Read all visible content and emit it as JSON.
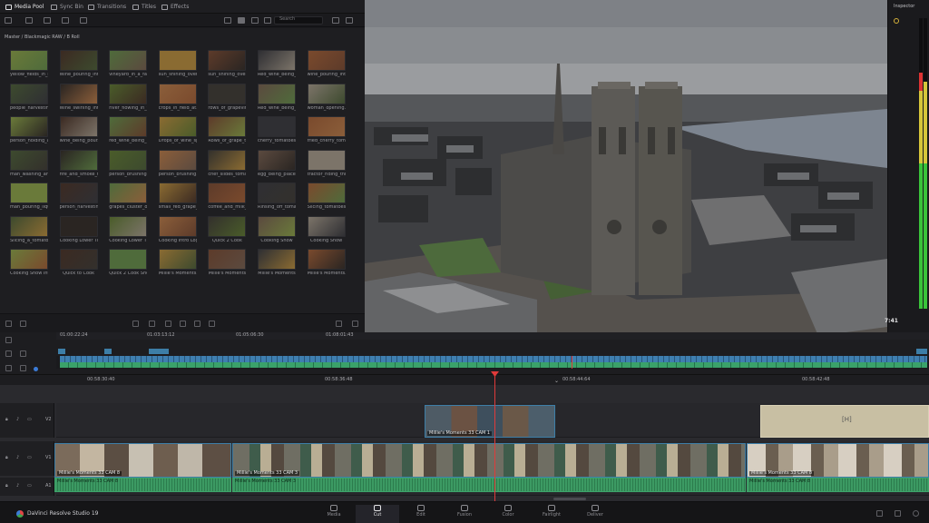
{
  "top_tabs": [
    "Media Pool",
    "Sync Bin",
    "Transitions",
    "Titles",
    "Effects"
  ],
  "search_placeholder": "Search",
  "breadcrumb": "Master / Blackmagic RAW / B Roll",
  "inspector_label": "Inspector",
  "viewer_timecode": "7:41",
  "clips": [
    [
      "yellow_fields_in_la...",
      "Wine_pouring_into...",
      "vineyard_in_a_far...",
      "sun_shining_over...",
      "sun_shining_over...",
      "Red_wine_being_pour...",
      "wine_pouring_into..."
    ],
    [
      "people_harvesting...",
      "Wine_swirling_into...",
      "river_flowing_in_t...",
      "crops_in_field_at...",
      "rows_of_grapevin...",
      "Red_wine_being_po...",
      "woman_opening..."
    ],
    [
      "person_holding_a...",
      "wine_being_pour...",
      "red_wine_being_p...",
      "Drops_of_wine_sp...",
      "Rows_of_grape_tr...",
      "cherry_tomatoes...",
      "fried_cherry_tomat..."
    ],
    [
      "man_washing_an...",
      "fire_and_smoke_f...",
      "person_brushing...",
      "person_brushing...",
      "chef_slides_tomat...",
      "egg_being_placed...",
      "tractor_riding_thro..."
    ],
    [
      "man_pouring_liqu...",
      "person_harvestin...",
      "grapes_cluster_on...",
      "small_red_grape_f...",
      "coffee_and_milk_b...",
      "Rinsing_off_tomat...",
      "Slicing_tomatoes..."
    ],
    [
      "Slicing_a_tomato...",
      "Cooking Lower Thi...",
      "Cooking Lower Thi...",
      "Cooking Intro Log...",
      "Quick 2 Cook",
      "Cooking Show",
      "Cooking Show"
    ],
    [
      "Cooking Show Int...",
      "Quick to Cook",
      "Quick 2 Cook Sheet",
      "Millie's Moments...",
      "Millie's Moments",
      "Millie's Moments",
      "Millie's Moments..."
    ]
  ],
  "ruler_marks": [
    "01:00:22:24",
    "01:03:13:12",
    "01:05:06:30",
    "01:08:01:43"
  ],
  "timeline_marks": [
    "00:58:30:40",
    "00:58:36:48",
    "00:58:44:64",
    "00:58:42:48"
  ],
  "tracks": {
    "v2": "V2",
    "v1": "V1",
    "a1": "A1"
  },
  "clip_labels": {
    "v2": "Millie's Moments 33 CAM 1",
    "v1_a": "Millie's Moments 33 CAM 8",
    "v1_b": "Millie's Moments 33 CAM 3",
    "v1_c": "Millie's Moments 33 CAM 8",
    "a1_a": "Millie's Moments 33 CAM 8",
    "a1_b": "Millie's Moments 33 CAM 3",
    "a1_c": "Millie's Moments 33 CAM 8"
  },
  "app_name": "DaVinci Resolve Studio 19",
  "pages": [
    "Media",
    "Cut",
    "Edit",
    "Fusion",
    "Color",
    "Fairlight",
    "Deliver"
  ],
  "active_page": "Cut",
  "colors": {
    "playhead": "#e03a3a",
    "video_clip": "#3d7ea7",
    "audio_clip": "#2f8a57",
    "accent": "#d33"
  }
}
